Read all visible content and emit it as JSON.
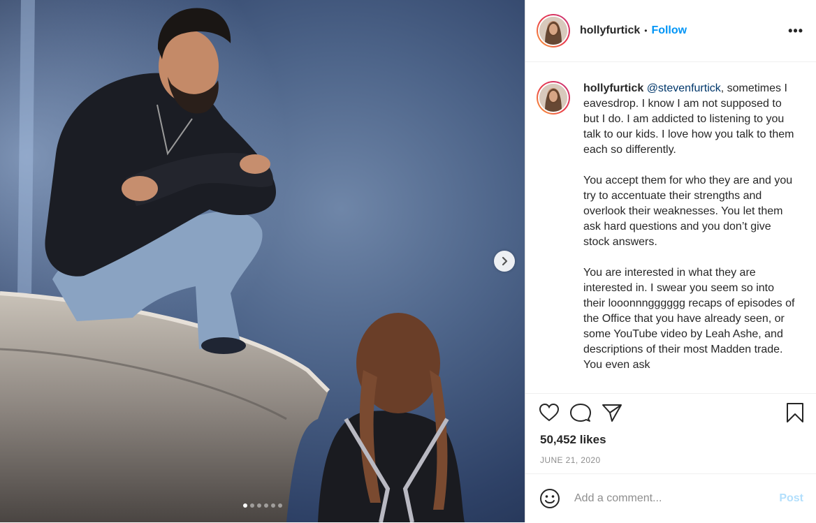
{
  "post": {
    "photo": {
      "description_icon": "photo-carousel",
      "carousel_total": 6,
      "carousel_active": 1
    },
    "header": {
      "username": "hollyfurtick",
      "separator": "•",
      "follow_label": "Follow",
      "more_label": "•••"
    },
    "caption": {
      "username": "hollyfurtick",
      "mention": "@stevenfurtick",
      "paragraphs": [
        ", sometimes I eavesdrop. I know I am not supposed to but I do. I am addicted to listening to you talk to our kids. I love how you talk to them each so differently.",
        "You accept them for who they are and you try to accentuate their strengths and overlook their weaknesses. You let them ask hard questions and you don’t give stock answers.",
        "You are interested in what they are interested in. I swear you seem so into their looonnngggggg recaps of episodes of the Office that you have already seen, or some YouTube video by Leah Ashe, and descriptions of their most Madden trade. You even ask"
      ]
    },
    "likes": "50,452 likes",
    "date": "JUNE 21, 2020",
    "comment": {
      "placeholder": "Add a comment...",
      "post_label": "Post"
    }
  },
  "colors": {
    "link": "#0095f6",
    "post_disabled": "#b2dffc",
    "muted": "#8e8e8e"
  }
}
